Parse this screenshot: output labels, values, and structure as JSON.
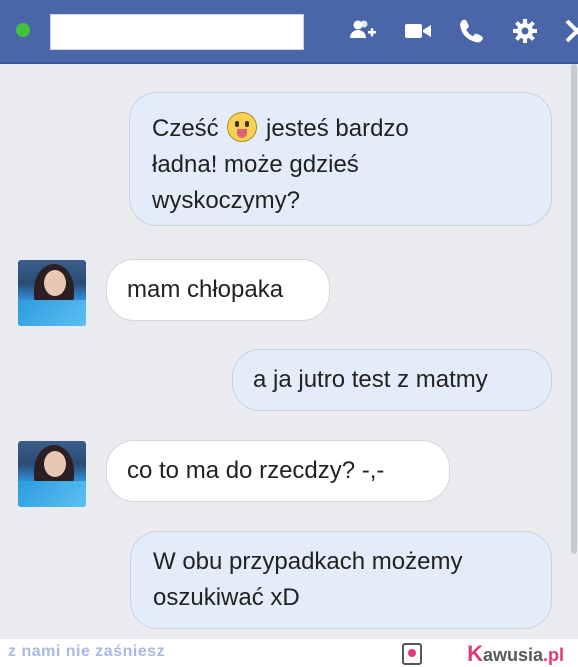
{
  "header": {
    "contact_name": "",
    "icons": [
      "add-people-icon",
      "video-call-icon",
      "phone-icon",
      "gear-icon",
      "close-icon"
    ],
    "online_color": "#42c23a",
    "bar_color": "#4a66a9"
  },
  "messages": [
    {
      "direction": "outgoing",
      "text_before_emoji": "Cześć ",
      "emoji": "tongue-out-emoji",
      "text_after_emoji": " jesteś bardzo",
      "line2": "ładna! może gdzieś",
      "line3": "wyskoczymy?"
    },
    {
      "direction": "incoming",
      "text": "mam chłopaka"
    },
    {
      "direction": "outgoing",
      "text": "a ja jutro test z matmy"
    },
    {
      "direction": "incoming",
      "text": "co to ma do rzecdzy? -,-"
    },
    {
      "direction": "outgoing",
      "line1": "W obu przypadkach możemy",
      "line2": "oszukiwać xD"
    }
  ],
  "footer": {
    "left_text": "z nami nie zaśniesz",
    "brand_k": "K",
    "brand_rest": "awusia",
    "brand_tld": ".pl"
  }
}
